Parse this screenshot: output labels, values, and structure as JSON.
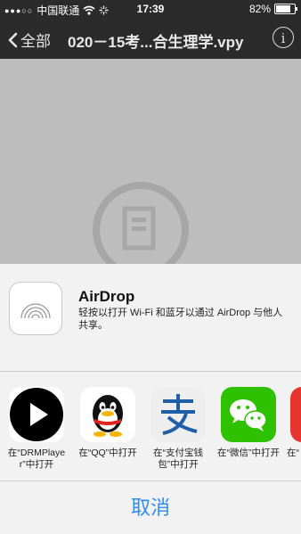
{
  "status_bar": {
    "carrier": "中国联通",
    "time": "17:39",
    "battery": "82%",
    "battery_level": 0.82
  },
  "nav": {
    "back_label": "全部",
    "title": "020－15考...合生理学.vpy",
    "info_glyph": "i"
  },
  "airdrop": {
    "title": "AirDrop",
    "description": "轻按以打开 Wi-Fi 和蓝牙以通过 AirDrop 与他人共享。"
  },
  "apps": [
    {
      "label": "在“DRMPlayer”中打开",
      "icon": "play-icon"
    },
    {
      "label": "在“QQ”中打开",
      "icon": "qq-penguin-icon"
    },
    {
      "label": "在“支付宝钱包”中打开",
      "icon": "alipay-icon"
    },
    {
      "label": "在“微信”中打开",
      "icon": "wechat-icon"
    },
    {
      "label": "在“",
      "icon": "app-icon"
    }
  ],
  "cancel_label": "取消",
  "colors": {
    "accent": "#2f8cf6",
    "wechat": "#2dc100",
    "alipay_blue": "#1f5fa8",
    "bar": "#2b2b2b"
  }
}
